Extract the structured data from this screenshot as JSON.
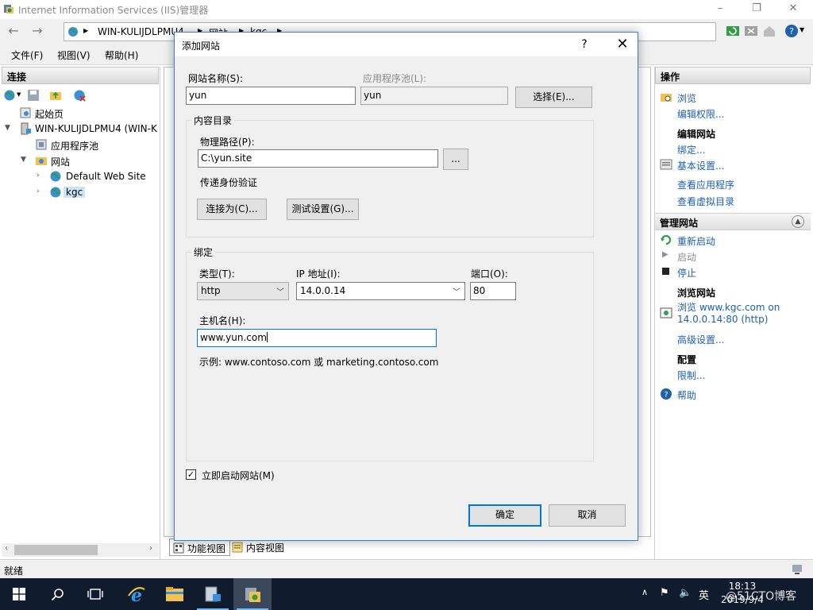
{
  "window": {
    "title": "Internet Information Services (IIS)管理器",
    "controls": {
      "minimize": "–",
      "restore": "❐",
      "close": "✕"
    }
  },
  "address": {
    "crumbs": [
      "WIN-KULIJDLPMU4",
      "网站",
      "kgc"
    ]
  },
  "menu": [
    "文件(F)",
    "视图(V)",
    "帮助(H)"
  ],
  "connections": {
    "header": "连接",
    "tree": [
      {
        "label": "起始页",
        "icon": "start-page-icon"
      },
      {
        "label": "WIN-KULIJDLPMU4 (WIN-K",
        "icon": "server-icon"
      },
      {
        "label": "应用程序池",
        "icon": "app-pool-icon"
      },
      {
        "label": "网站",
        "icon": "sites-folder-icon"
      },
      {
        "label": "Default Web Site",
        "icon": "globe-icon"
      },
      {
        "label": "kgc",
        "icon": "globe-icon"
      }
    ]
  },
  "view_tabs": {
    "features": "功能视图",
    "content": "内容视图"
  },
  "actions": {
    "header": "操作",
    "browse": "浏览",
    "edit_permissions": "编辑权限...",
    "edit_site_heading": "编辑网站",
    "bindings": "绑定...",
    "basic_settings": "基本设置...",
    "view_apps": "查看应用程序",
    "view_vdirs": "查看虚拟目录",
    "manage_site": "管理网站",
    "restart": "重新启动",
    "start": "启动",
    "stop": "停止",
    "browse_site_heading": "浏览网站",
    "browse_link_1": "浏览 www.kgc.com on",
    "browse_link_2": "14.0.0.14:80 (http)",
    "advanced_settings": "高级设置...",
    "config_heading": "配置",
    "limits": "限制...",
    "help": "帮助"
  },
  "status": {
    "text": "就绪"
  },
  "dialog": {
    "title": "添加网站",
    "help": "?",
    "close": "✕",
    "site_name_label": "网站名称(S):",
    "site_name_value": "yun",
    "app_pool_label": "应用程序池(L):",
    "app_pool_value": "yun",
    "select_button": "选择(E)...",
    "content_dir_label": "内容目录",
    "physical_path_label": "物理路径(P):",
    "physical_path_value": "C:\\yun.site",
    "browse_button": "...",
    "pass_through_label": "传递身份验证",
    "connect_as_button": "连接为(C)...",
    "test_settings_button": "测试设置(G)...",
    "binding_label": "绑定",
    "type_label": "类型(T):",
    "type_value": "http",
    "ip_label": "IP 地址(I):",
    "ip_value": "14.0.0.14",
    "port_label": "端口(O):",
    "port_value": "80",
    "hostname_label": "主机名(H):",
    "hostname_value": "www.yun.com",
    "example_text": "示例: www.contoso.com 或 marketing.contoso.com",
    "start_now_label": "立即启动网站(M)",
    "start_now_checked": true,
    "ok_button": "确定",
    "cancel_button": "取消"
  },
  "taskbar": {
    "tray_lang": "英",
    "time": "18:13",
    "date": "2019/9/4",
    "watermark": "@51CTO博客"
  },
  "colors": {
    "accent": "#0078d7",
    "link": "#1d60b0",
    "taskbar": "#101b2d"
  }
}
